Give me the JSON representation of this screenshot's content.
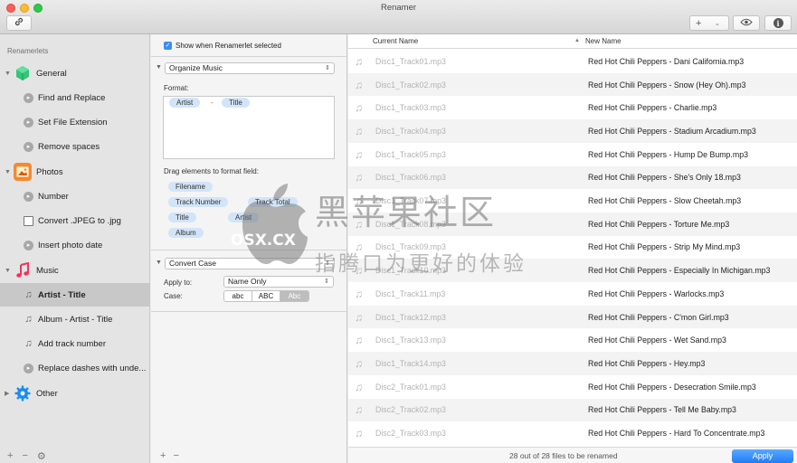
{
  "window": {
    "title": "Renamer"
  },
  "toolbar": {
    "add_label": "+",
    "add_chevron": "⌄"
  },
  "sidebar": {
    "header": "Renamerlets",
    "categories": [
      {
        "label": "General",
        "icon": "cube-icon",
        "color": "#2fb86e",
        "items": [
          {
            "label": "Find and Replace",
            "icon": "renamerlet-icon"
          },
          {
            "label": "Set File Extension",
            "icon": "renamerlet-icon"
          },
          {
            "label": "Remove spaces",
            "icon": "renamerlet-icon"
          }
        ]
      },
      {
        "label": "Photos",
        "icon": "photos-icon",
        "color": "#f07c2a",
        "items": [
          {
            "label": "Number",
            "icon": "renamerlet-icon"
          },
          {
            "label": "Convert .JPEG to .jpg",
            "icon": "image-icon"
          },
          {
            "label": "Insert photo date",
            "icon": "renamerlet-icon"
          }
        ]
      },
      {
        "label": "Music",
        "icon": "music-note-icon",
        "color": "#f5315c",
        "items": [
          {
            "label": "Artist - Title",
            "icon": "note-icon",
            "selected": true
          },
          {
            "label": "Album - Artist - Title",
            "icon": "note-icon"
          },
          {
            "label": "Add track number",
            "icon": "note-icon"
          },
          {
            "label": "Replace dashes with unde...",
            "icon": "renamerlet-icon"
          }
        ]
      },
      {
        "label": "Other",
        "icon": "gear-icon",
        "color": "#1b8cf0",
        "items": []
      }
    ],
    "bottom": {
      "add": "+",
      "remove": "−",
      "action": "⚙"
    }
  },
  "middle": {
    "show_when_selected": {
      "label": "Show when Renamerlet selected",
      "checked": true
    },
    "organize": {
      "popup_value": "Organize Music",
      "format_label": "Format:",
      "format_tokens": [
        "Artist",
        "Title"
      ],
      "format_separator": "-",
      "drag_label": "Drag elements to format field:",
      "elements": [
        "Filename",
        "Track Number",
        "Track Total",
        "Title",
        "Artist",
        "Album"
      ]
    },
    "convert_case": {
      "popup_value": "Convert Case",
      "apply_to_label": "Apply to:",
      "apply_to_value": "Name Only",
      "case_label": "Case:",
      "case_options": [
        "abc",
        "ABC",
        "Abc"
      ],
      "case_selected": "Abc"
    },
    "bottom": {
      "add": "+",
      "remove": "−"
    }
  },
  "table": {
    "columns": {
      "current": "Current Name",
      "new": "New Name",
      "sort_arrow": "▲"
    },
    "rows": [
      {
        "current": "Disc1_Track01.mp3",
        "new": "Red Hot Chili Peppers - Dani California.mp3"
      },
      {
        "current": "Disc1_Track02.mp3",
        "new": "Red Hot Chili Peppers - Snow (Hey Oh).mp3"
      },
      {
        "current": "Disc1_Track03.mp3",
        "new": "Red Hot Chili Peppers - Charlie.mp3"
      },
      {
        "current": "Disc1_Track04.mp3",
        "new": "Red Hot Chili Peppers - Stadium Arcadium.mp3"
      },
      {
        "current": "Disc1_Track05.mp3",
        "new": "Red Hot Chili Peppers - Hump De Bump.mp3"
      },
      {
        "current": "Disc1_Track06.mp3",
        "new": "Red Hot Chili Peppers - She's Only 18.mp3"
      },
      {
        "current": "Disc1_Track07.mp3",
        "new": "Red Hot Chili Peppers - Slow Cheetah.mp3"
      },
      {
        "current": "Disc1_Track08.mp3",
        "new": "Red Hot Chili Peppers - Torture Me.mp3"
      },
      {
        "current": "Disc1_Track09.mp3",
        "new": "Red Hot Chili Peppers - Strip My Mind.mp3"
      },
      {
        "current": "Disc1_Track10.mp3",
        "new": "Red Hot Chili Peppers - Especially In Michigan.mp3"
      },
      {
        "current": "Disc1_Track11.mp3",
        "new": "Red Hot Chili Peppers - Warlocks.mp3"
      },
      {
        "current": "Disc1_Track12.mp3",
        "new": "Red Hot Chili Peppers - C'mon Girl.mp3"
      },
      {
        "current": "Disc1_Track13.mp3",
        "new": "Red Hot Chili Peppers - Wet Sand.mp3"
      },
      {
        "current": "Disc1_Track14.mp3",
        "new": "Red Hot Chili Peppers - Hey.mp3"
      },
      {
        "current": "Disc2_Track01.mp3",
        "new": "Red Hot Chili Peppers - Desecration Smile.mp3"
      },
      {
        "current": "Disc2_Track02.mp3",
        "new": "Red Hot Chili Peppers - Tell Me Baby.mp3"
      },
      {
        "current": "Disc2_Track03.mp3",
        "new": "Red Hot Chili Peppers - Hard To Concentrate.mp3"
      }
    ],
    "status": "28 out of 28 files to be renamed",
    "apply_label": "Apply"
  },
  "watermark": {
    "cn": "黑苹果社区",
    "osx": "OSX.CX",
    "sub": "指腾口为更好的体验"
  }
}
